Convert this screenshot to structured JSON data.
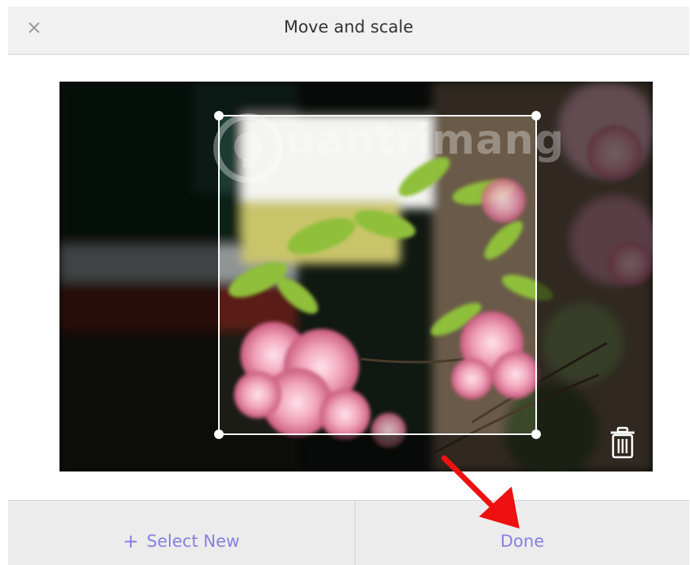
{
  "dialog": {
    "title": "Move and scale",
    "close_icon": "close-icon",
    "watermark_text": "uantrimang"
  },
  "editor": {
    "trash_icon": "trash-icon"
  },
  "footer": {
    "select_new_plus": "+",
    "select_new_label": "Select New",
    "done_label": "Done"
  },
  "colors": {
    "accent": "#8a7ee0",
    "header_bg": "#f1f1f1",
    "footer_bg": "#ececec",
    "annotation_arrow": "#ee1111"
  }
}
